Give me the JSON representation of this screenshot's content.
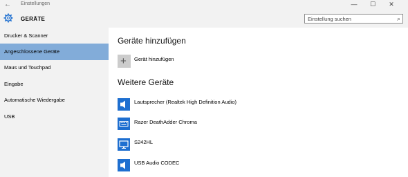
{
  "window": {
    "title": "Einstellungen",
    "minimize": "—",
    "maximize": "☐",
    "close": "✕"
  },
  "header": {
    "title": "GERÄTE"
  },
  "search": {
    "placeholder": "Einstellung suchen"
  },
  "sidebar": {
    "items": [
      {
        "label": "Drucker & Scanner",
        "active": false
      },
      {
        "label": "Angeschlossene Geräte",
        "active": true
      },
      {
        "label": "Maus und Touchpad",
        "active": false
      },
      {
        "label": "Eingabe",
        "active": false
      },
      {
        "label": "Automatische Wiedergabe",
        "active": false
      },
      {
        "label": "USB",
        "active": false
      }
    ]
  },
  "main": {
    "add_section_title": "Geräte hinzufügen",
    "add_button_label": "Gerät hinzufügen",
    "other_section_title": "Weitere Geräte",
    "devices": [
      {
        "label": "Lautsprecher (Realtek High Definition Audio)",
        "icon": "speaker-icon"
      },
      {
        "label": "Razer DeathAdder Chroma",
        "icon": "keyboard-icon"
      },
      {
        "label": "S242HL",
        "icon": "monitor-icon"
      },
      {
        "label": "USB Audio CODEC",
        "icon": "speaker-icon"
      }
    ]
  },
  "colors": {
    "accent": "#1e6fd0",
    "active_item": "#82acd9"
  }
}
